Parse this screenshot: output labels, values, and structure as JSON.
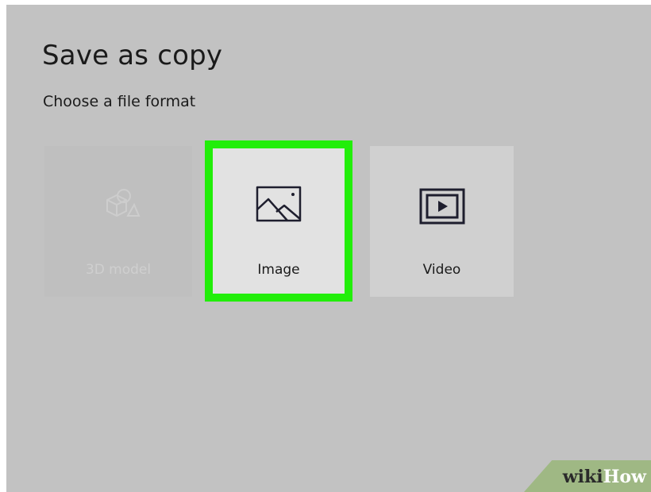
{
  "dialog": {
    "title": "Save as copy",
    "subtitle": "Choose a file format"
  },
  "formats": [
    {
      "label": "3D model",
      "icon": "3d-shapes-icon",
      "state": "disabled"
    },
    {
      "label": "Image",
      "icon": "image-icon",
      "state": "highlighted"
    },
    {
      "label": "Video",
      "icon": "video-icon",
      "state": "normal"
    }
  ],
  "colors": {
    "background": "#c2c2c2",
    "highlight": "#22ee0a",
    "tile_selected": "#e2e2e2",
    "tile_normal": "#d0d0d0"
  },
  "watermark": {
    "part1": "wiki",
    "part2": "How"
  }
}
